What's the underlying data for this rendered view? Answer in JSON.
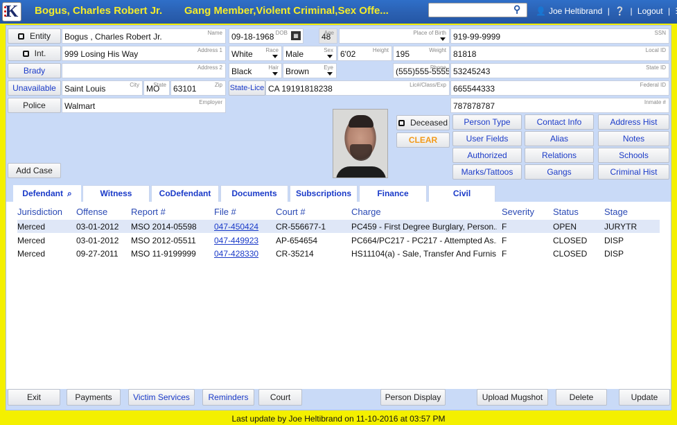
{
  "header": {
    "logo": "K",
    "name": "Bogus, Charles Robert Jr.",
    "tags": "Gang Member,Violent Criminal,Sex Offe...",
    "search_value": "",
    "user": "Joe Heltibrand",
    "logout": "Logout",
    "sep": "|"
  },
  "left": {
    "entity": "Entity",
    "int": "Int.",
    "brady": "Brady",
    "unavailable": "Unavailable",
    "police": "Police",
    "name": {
      "value": "Bogus , Charles Robert Jr.",
      "label": "Name"
    },
    "address1": {
      "value": "999 Losing His Way",
      "label": "Address 1"
    },
    "address2": {
      "value": "",
      "label": "Address 2"
    },
    "city": {
      "value": "Saint Louis",
      "label": "City"
    },
    "state": {
      "value": "MO",
      "label": "State"
    },
    "zip": {
      "value": "63101",
      "label": "Zip"
    },
    "employer": {
      "value": "Walmart",
      "label": "Employer"
    }
  },
  "mid": {
    "dob": {
      "value": "09-18-1968",
      "label": "DOB"
    },
    "age": {
      "value": "48",
      "label": "Age"
    },
    "pob": {
      "value": "",
      "label": "Place of Birth"
    },
    "race": {
      "value": "White",
      "label": "Race"
    },
    "sex": {
      "value": "Male",
      "label": "Sex"
    },
    "height": {
      "value": "6'02",
      "label": "Height"
    },
    "weight": {
      "value": "195",
      "label": "Weight"
    },
    "hair": {
      "value": "Black",
      "label": "Hair"
    },
    "eye": {
      "value": "Brown",
      "label": "Eye"
    },
    "phone": {
      "value": "(555)555-5555",
      "label": "Phone"
    },
    "state_lic_btn": "State-Lice",
    "lic": {
      "value": "CA 19191818238",
      "label": "Lic#/Class/Exp"
    },
    "deceased": "Deceased",
    "clear": "CLEAR"
  },
  "ids": [
    {
      "value": "919-99-9999",
      "label": "SSN"
    },
    {
      "value": "81818",
      "label": "Local ID"
    },
    {
      "value": "53245243",
      "label": "State ID"
    },
    {
      "value": "665544333",
      "label": "Federal ID"
    },
    {
      "value": "787878787",
      "label": "Inmate #"
    }
  ],
  "action_buttons": [
    "Person Type",
    "Contact Info",
    "Address Hist",
    "User Fields",
    "Alias",
    "Notes",
    "Authorized",
    "Relations",
    "Schools",
    "Marks/Tattoos",
    "Gangs",
    "Criminal Hist"
  ],
  "add_case": "Add Case",
  "tabs": [
    "Defendant",
    "Witness",
    "CoDefendant",
    "Documents",
    "Subscriptions",
    "Finance",
    "Civil"
  ],
  "table": {
    "headers": [
      "Jurisdiction",
      "Offense",
      "Report #",
      "File #",
      "Court #",
      "Charge",
      "Severity",
      "Status",
      "Stage"
    ],
    "rows": [
      [
        "Merced",
        "03-01-2012",
        "MSO 2014-05598",
        "047-450424",
        "CR-556677-1",
        "PC459 - First Degree Burglary, Person...",
        "F",
        "OPEN",
        "JURYTR"
      ],
      [
        "Merced",
        "03-01-2012",
        "MSO 2012-05511",
        "047-449923",
        "AP-654654",
        "PC664/PC217 - PC217 - Attempted As...",
        "F",
        "CLOSED",
        "DISP"
      ],
      [
        "Merced",
        "09-27-2011",
        "MSO 11-9199999",
        "047-428330",
        "CR-35214",
        "HS11104(a) - Sale, Transfer And Furnis...",
        "F",
        "CLOSED",
        "DISP"
      ]
    ]
  },
  "bottom": [
    "Exit",
    "Payments",
    "Victim Services",
    "Reminders",
    "Court",
    "Person Display",
    "Upload Mugshot",
    "Delete",
    "Update"
  ],
  "footer": "Last update by Joe Heltibrand on 11-10-2016 at 03:57 PM"
}
